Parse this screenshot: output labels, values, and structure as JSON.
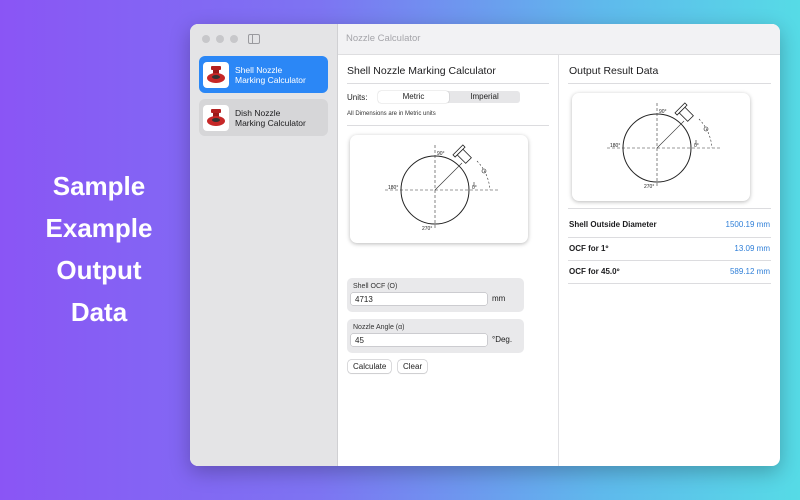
{
  "promo": {
    "lines": [
      "Sample",
      "Example",
      "Output",
      "Data"
    ]
  },
  "window": {
    "title": "Nozzle Calculator"
  },
  "sidebar": {
    "items": [
      {
        "line1": "Shell Nozzle",
        "line2": "Marking Calculator",
        "active": true
      },
      {
        "line1": "Dish Nozzle",
        "line2": "Marking Calculator",
        "active": false
      }
    ]
  },
  "calculator": {
    "title": "Shell Nozzle Marking Calculator",
    "units_label": "Units:",
    "units_options": [
      "Metric",
      "Imperial"
    ],
    "units_selected": "Metric",
    "note": "All Dimensions are in Metric units",
    "diagram_labels": {
      "top": "90°",
      "left": "180°",
      "right": "0°",
      "bottom": "270°"
    },
    "fields": [
      {
        "label": "Shell OCF (O)",
        "value": "4713",
        "unit": "mm"
      },
      {
        "label": "Nozzle Angle (α)",
        "value": "45",
        "unit": "°Deg."
      }
    ],
    "buttons": {
      "calculate": "Calculate",
      "clear": "Clear"
    }
  },
  "output": {
    "title": "Output Result Data",
    "rows": [
      {
        "label": "Shell Outside Diameter",
        "value": "1500.19 mm"
      },
      {
        "label": "OCF for 1º",
        "value": "13.09 mm"
      },
      {
        "label": "OCF for 45.0º",
        "value": "589.12 mm"
      }
    ]
  },
  "colors": {
    "accent": "#2b87f6",
    "value_text": "#2f7fd8",
    "sidebar_bg": "#e4e4e6"
  }
}
